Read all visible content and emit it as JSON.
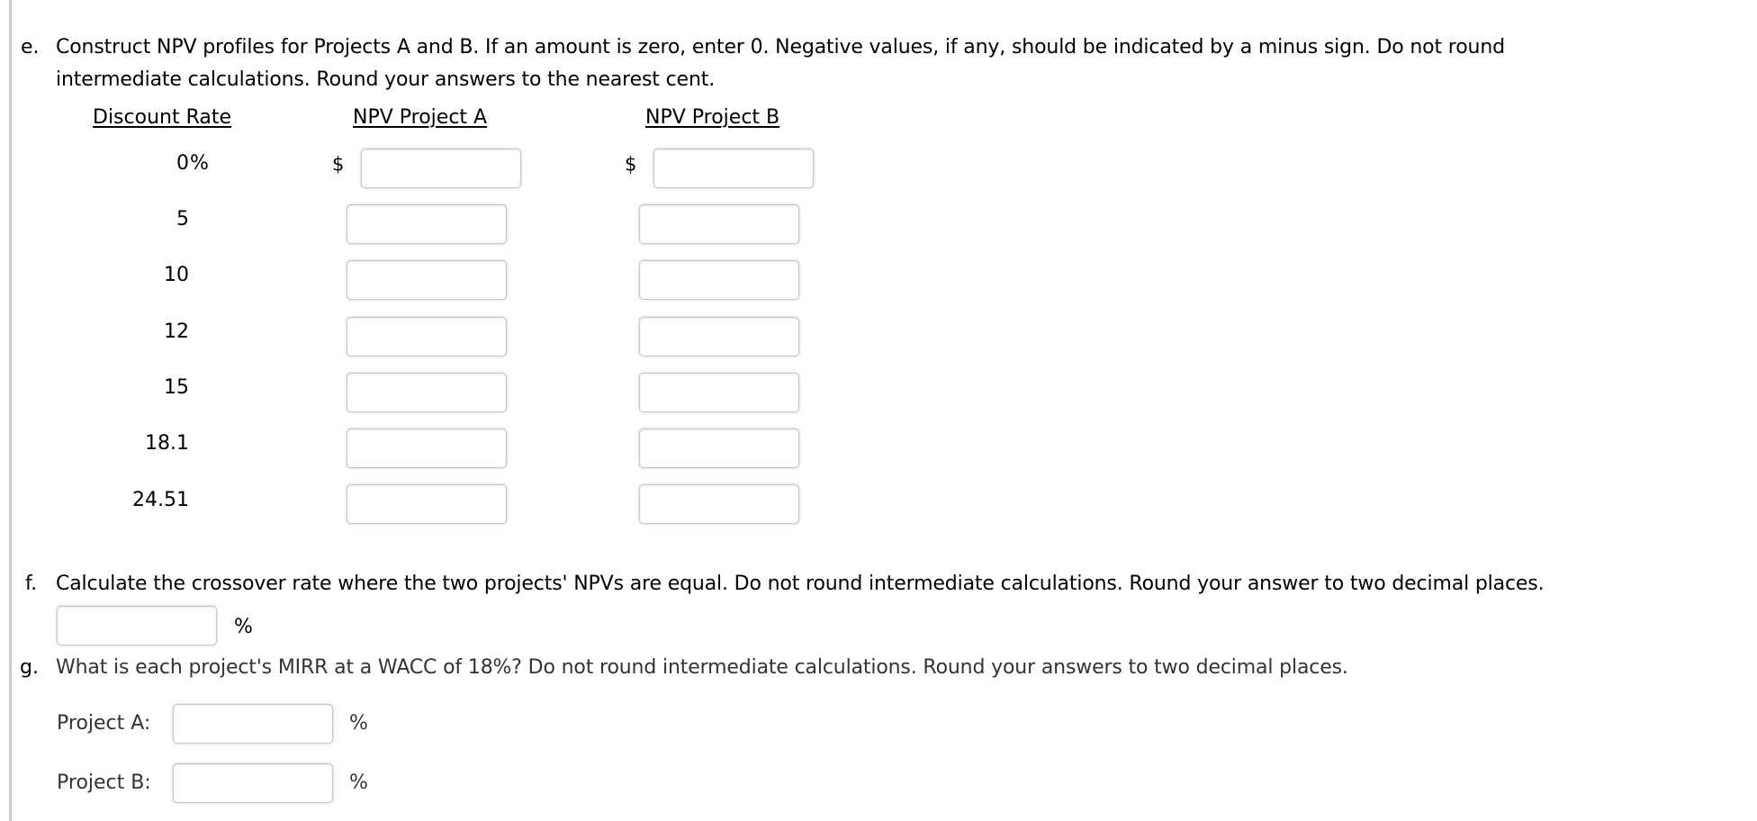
{
  "section_e": {
    "marker": "e.",
    "line1": "Construct NPV profiles for Projects A and B. If an amount is zero, enter 0. Negative values, if any, should be indicated by a minus sign. Do not round",
    "line2": "intermediate calculations. Round your answers to the nearest cent.",
    "table": {
      "headers": {
        "rate": "Discount Rate",
        "npv_a": "NPV Project A",
        "npv_b": "NPV Project B"
      },
      "currency_symbol": "$",
      "rows": [
        {
          "rate": "0",
          "rate_suffix": "%",
          "npv_a": "",
          "npv_b": ""
        },
        {
          "rate": "5",
          "rate_suffix": "",
          "npv_a": "",
          "npv_b": ""
        },
        {
          "rate": "10",
          "rate_suffix": "",
          "npv_a": "",
          "npv_b": ""
        },
        {
          "rate": "12",
          "rate_suffix": "",
          "npv_a": "",
          "npv_b": ""
        },
        {
          "rate": "15",
          "rate_suffix": "",
          "npv_a": "",
          "npv_b": ""
        },
        {
          "rate": "18.1",
          "rate_suffix": "",
          "npv_a": "",
          "npv_b": ""
        },
        {
          "rate": "24.51",
          "rate_suffix": "",
          "npv_a": "",
          "npv_b": ""
        }
      ]
    }
  },
  "section_f": {
    "marker": "f.",
    "text": "Calculate the crossover rate where the two projects' NPVs are equal. Do not round intermediate calculations. Round your answer to two decimal places.",
    "crossover_value": "",
    "unit": "%"
  },
  "section_g": {
    "marker": "g.",
    "text": "What is each project's MIRR at a WACC of 18%? Do not round intermediate calculations. Round your answers to two decimal places.",
    "items": [
      {
        "label": "Project A:",
        "value": "",
        "unit": "%"
      },
      {
        "label": "Project B:",
        "value": "",
        "unit": "%"
      }
    ]
  }
}
